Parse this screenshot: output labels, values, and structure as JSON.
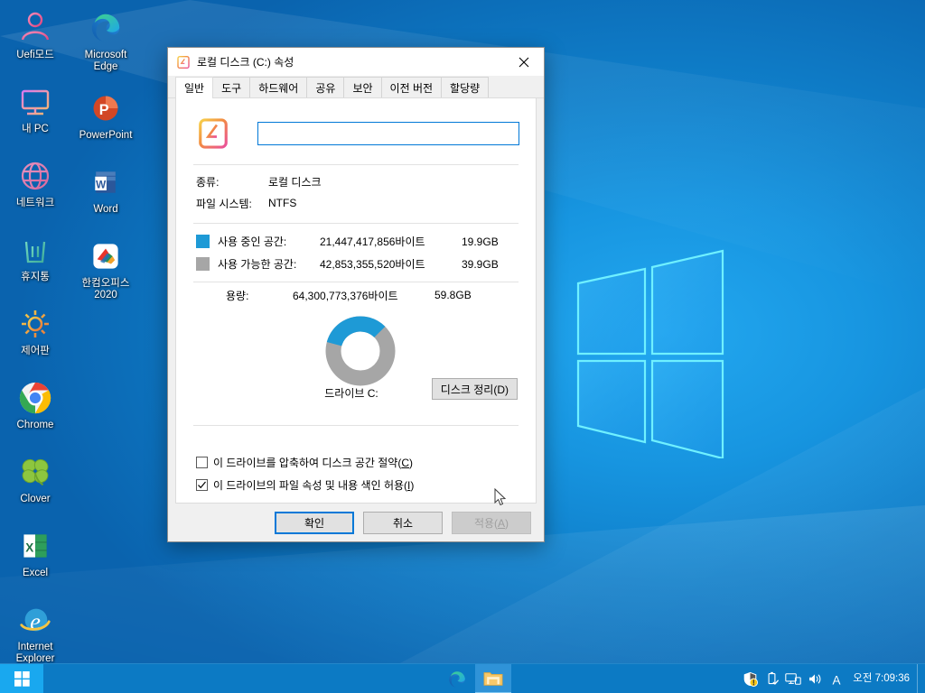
{
  "desktop": {
    "icons": [
      {
        "name": "uefi-mode",
        "label": "Uefi모드",
        "icon": "user-outline-icon"
      },
      {
        "name": "microsoft-edge",
        "label": "Microsoft Edge",
        "icon": "edge-icon"
      },
      {
        "name": "my-pc",
        "label": "내 PC",
        "icon": "monitor-outline-icon"
      },
      {
        "name": "powerpoint",
        "label": "PowerPoint",
        "icon": "powerpoint-icon"
      },
      {
        "name": "network",
        "label": "네트워크",
        "icon": "globe-outline-icon"
      },
      {
        "name": "word",
        "label": "Word",
        "icon": "word-icon"
      },
      {
        "name": "recycle-bin",
        "label": "휴지통",
        "icon": "trash-outline-icon"
      },
      {
        "name": "hancom-office-2020",
        "label": "한컴오피스 2020",
        "icon": "hancom-icon"
      },
      {
        "name": "control-panel",
        "label": "제어판",
        "icon": "gear-outline-icon"
      },
      {
        "name": "chrome",
        "label": "Chrome",
        "icon": "chrome-icon"
      },
      {
        "name": "clover",
        "label": "Clover",
        "icon": "clover-icon"
      },
      {
        "name": "excel",
        "label": "Excel",
        "icon": "excel-icon"
      },
      {
        "name": "internet-explorer",
        "label": "Internet Explorer",
        "icon": "ie-icon"
      }
    ]
  },
  "taskbar": {
    "start_icon": "windows-logo-icon",
    "apps": [
      {
        "name": "taskbar-edge",
        "icon": "edge-icon",
        "active": false
      },
      {
        "name": "taskbar-file-explorer",
        "icon": "folder-icon",
        "active": true
      }
    ],
    "tray": [
      {
        "name": "security-warning-icon",
        "icon": "shield-warning-icon"
      },
      {
        "name": "safely-remove-hardware-icon",
        "icon": "usb-eject-icon"
      },
      {
        "name": "network-icon",
        "icon": "network-monitor-icon"
      },
      {
        "name": "volume-icon",
        "icon": "speaker-icon"
      },
      {
        "name": "ime-icon",
        "icon": "ime-a-icon"
      }
    ],
    "clock": "오전 7:09:36"
  },
  "dialog": {
    "title": "로컬 디스크 (C:) 속성",
    "title_icon": "local-disk-icon",
    "close_label": "✕",
    "tabs": [
      {
        "label": "일반",
        "active": true
      },
      {
        "label": "도구",
        "active": false
      },
      {
        "label": "하드웨어",
        "active": false
      },
      {
        "label": "공유",
        "active": false
      },
      {
        "label": "보안",
        "active": false
      },
      {
        "label": "이전 버전",
        "active": false
      },
      {
        "label": "할당량",
        "active": false
      }
    ],
    "general": {
      "drive_icon": "local-disk-icon",
      "volume_label_value": "",
      "volume_label_placeholder": "",
      "type_key": "종류:",
      "type_value": "로컬 디스크",
      "filesystem_key": "파일 시스템:",
      "filesystem_value": "NTFS",
      "used_label": "사용 중인 공간:",
      "used_bytes": "21,447,417,856바이트",
      "used_gb": "19.9GB",
      "used_color": "#1e9ad6",
      "free_label": "사용 가능한 공간:",
      "free_bytes": "42,853,355,520바이트",
      "free_gb": "39.9GB",
      "free_color": "#a6a6a6",
      "capacity_label": "용량:",
      "capacity_bytes": "64,300,773,376바이트",
      "capacity_gb": "59.8GB",
      "drive_caption": "드라이브 C:",
      "cleanup_button": "디스크 정리(D)",
      "cleanup_accel": "D",
      "compress_checkbox": {
        "label_before": "이 드라이브를 압축하여 디스크 공간 절약(",
        "accel": "C",
        "label_after": ")",
        "checked": false
      },
      "index_checkbox": {
        "label_before": "이 드라이브의 파일 속성 및 내용 색인 허용(",
        "accel": "I",
        "label_after": ")",
        "checked": true
      }
    },
    "buttons": {
      "ok": "확인",
      "cancel": "취소",
      "apply_before": "적용(",
      "apply_accel": "A",
      "apply_after": ")",
      "apply_disabled": true
    }
  },
  "chart_data": {
    "type": "pie",
    "title": "드라이브 C:",
    "categories": [
      "사용 중인 공간",
      "사용 가능한 공간"
    ],
    "values": [
      21447417856,
      42853355520
    ],
    "values_gb": [
      19.9,
      39.9
    ],
    "percentages": [
      33.4,
      66.6
    ],
    "colors": [
      "#1e9ad6",
      "#a6a6a6"
    ],
    "total": 64300773376,
    "total_gb": 59.8,
    "units": "bytes",
    "donut": true,
    "legend_position": "top-list"
  }
}
